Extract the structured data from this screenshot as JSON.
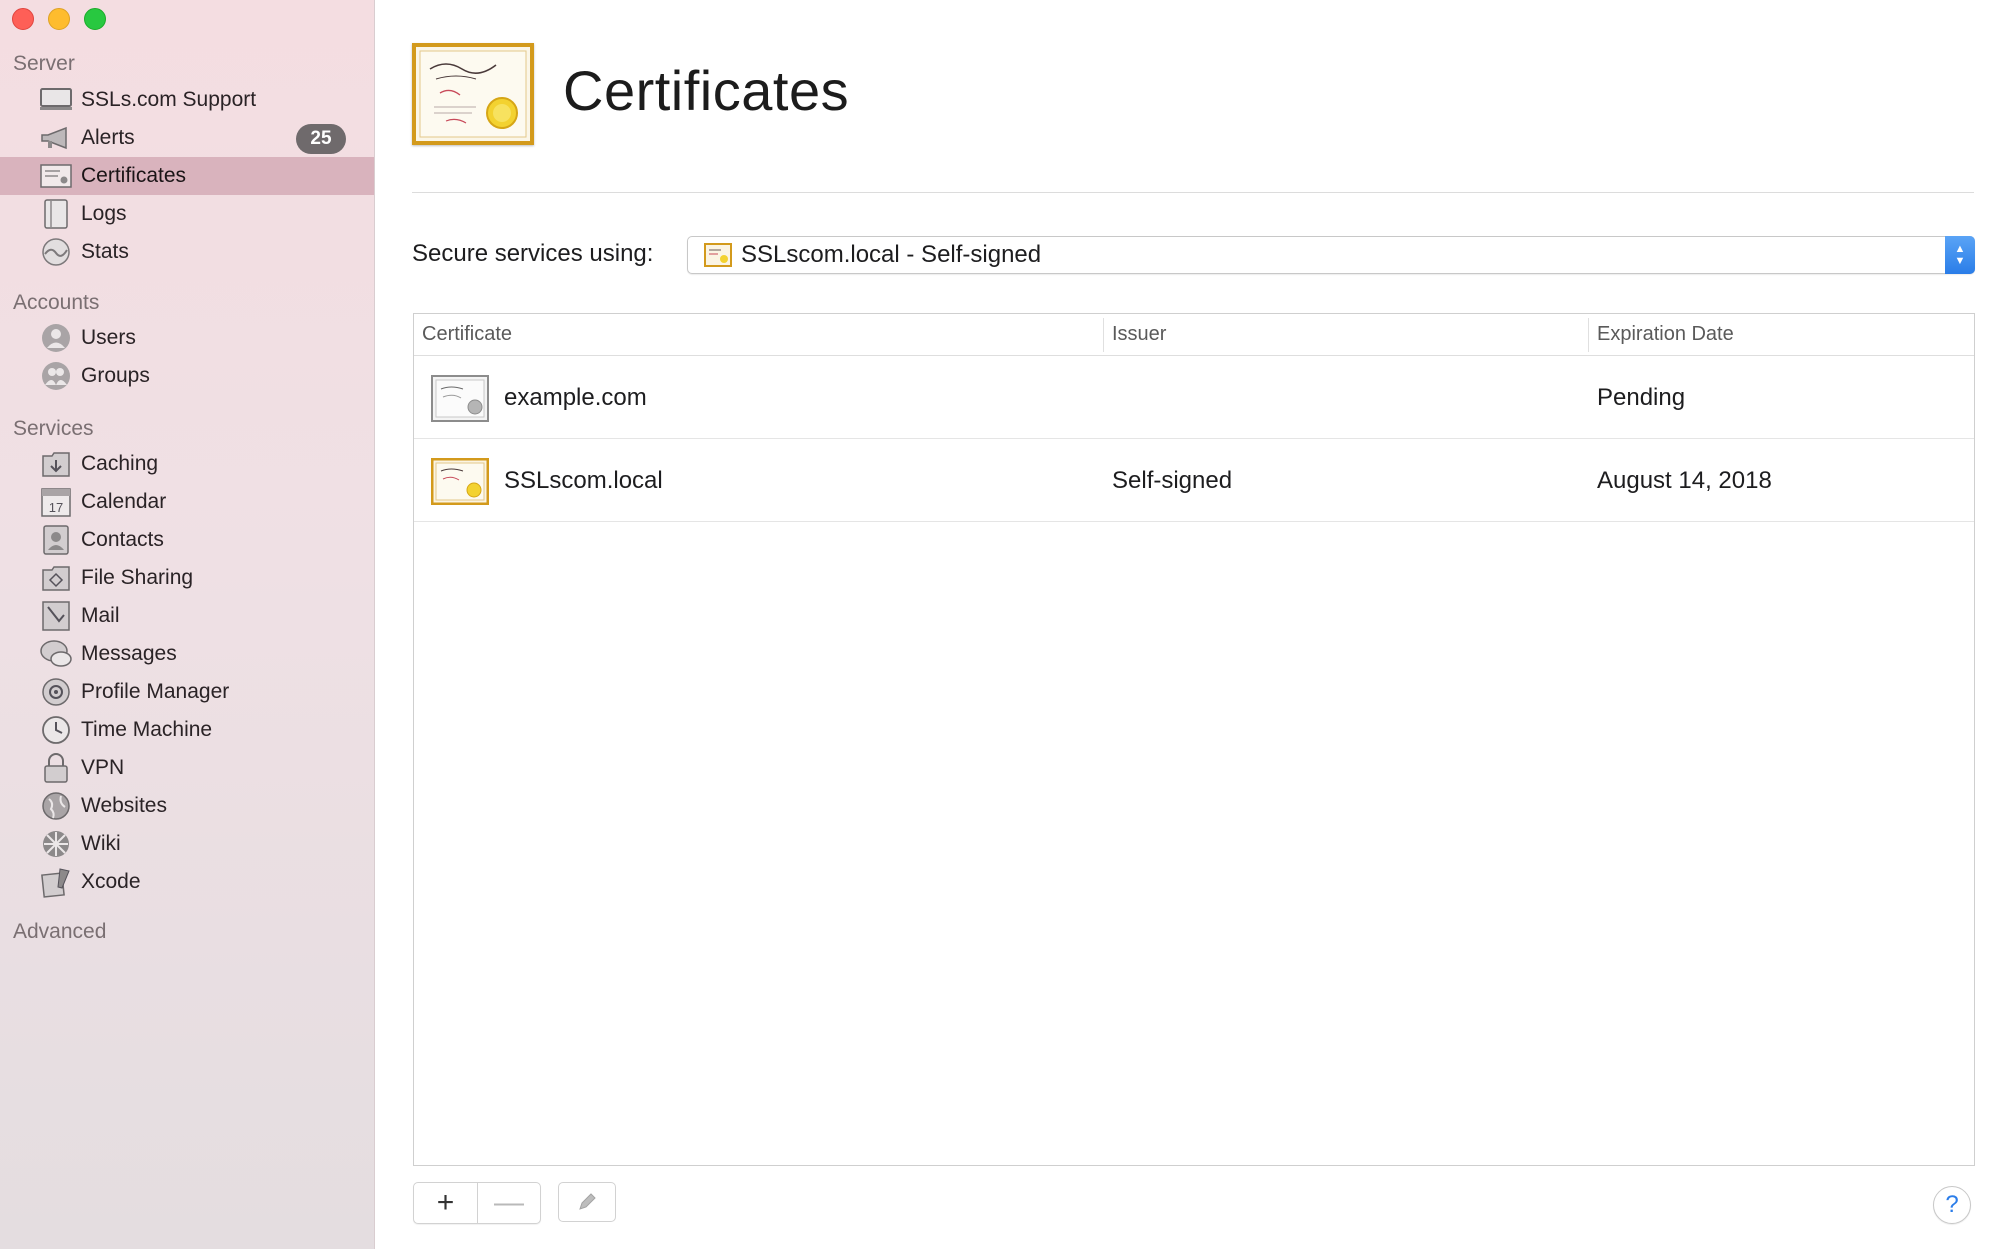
{
  "sidebar": {
    "sections": {
      "server": "Server",
      "accounts": "Accounts",
      "services": "Services",
      "advanced": "Advanced"
    },
    "server_items": [
      {
        "label": "SSLs.com Support",
        "icon": "display-icon"
      },
      {
        "label": "Alerts",
        "icon": "megaphone-icon",
        "badge": "25"
      },
      {
        "label": "Certificates",
        "icon": "certificate-icon",
        "selected": true
      },
      {
        "label": "Logs",
        "icon": "log-book-icon"
      },
      {
        "label": "Stats",
        "icon": "stats-icon"
      }
    ],
    "account_items": [
      {
        "label": "Users",
        "icon": "user-icon"
      },
      {
        "label": "Groups",
        "icon": "group-icon"
      }
    ],
    "service_items": [
      {
        "label": "Caching",
        "icon": "caching-icon"
      },
      {
        "label": "Calendar",
        "icon": "calendar-icon",
        "icon_text": "17"
      },
      {
        "label": "Contacts",
        "icon": "contacts-icon"
      },
      {
        "label": "File Sharing",
        "icon": "file-sharing-icon"
      },
      {
        "label": "Mail",
        "icon": "mail-icon"
      },
      {
        "label": "Messages",
        "icon": "messages-icon"
      },
      {
        "label": "Profile Manager",
        "icon": "profile-manager-icon"
      },
      {
        "label": "Time Machine",
        "icon": "time-machine-icon"
      },
      {
        "label": "VPN",
        "icon": "vpn-lock-icon"
      },
      {
        "label": "Websites",
        "icon": "globe-icon"
      },
      {
        "label": "Wiki",
        "icon": "wiki-icon"
      },
      {
        "label": "Xcode",
        "icon": "xcode-icon"
      }
    ]
  },
  "main": {
    "title": "Certificates",
    "secure_label": "Secure services using:",
    "secure_value": "SSLscom.local - Self-signed",
    "table": {
      "columns": [
        "Certificate",
        "Issuer",
        "Expiration Date"
      ],
      "rows": [
        {
          "certificate": "example.com",
          "issuer": "",
          "expiration": "Pending",
          "icon": "pending-certificate-icon"
        },
        {
          "certificate": "SSLscom.local",
          "issuer": "Self-signed",
          "expiration": "August 14, 2018",
          "icon": "root-certificate-icon"
        }
      ]
    },
    "buttons": {
      "add": "+",
      "remove": "—",
      "help": "?"
    }
  },
  "colors": {
    "selected_row": "#d9b3bd",
    "accent_blue": "#2a7de8",
    "cert_gold": "#d39a1c"
  }
}
